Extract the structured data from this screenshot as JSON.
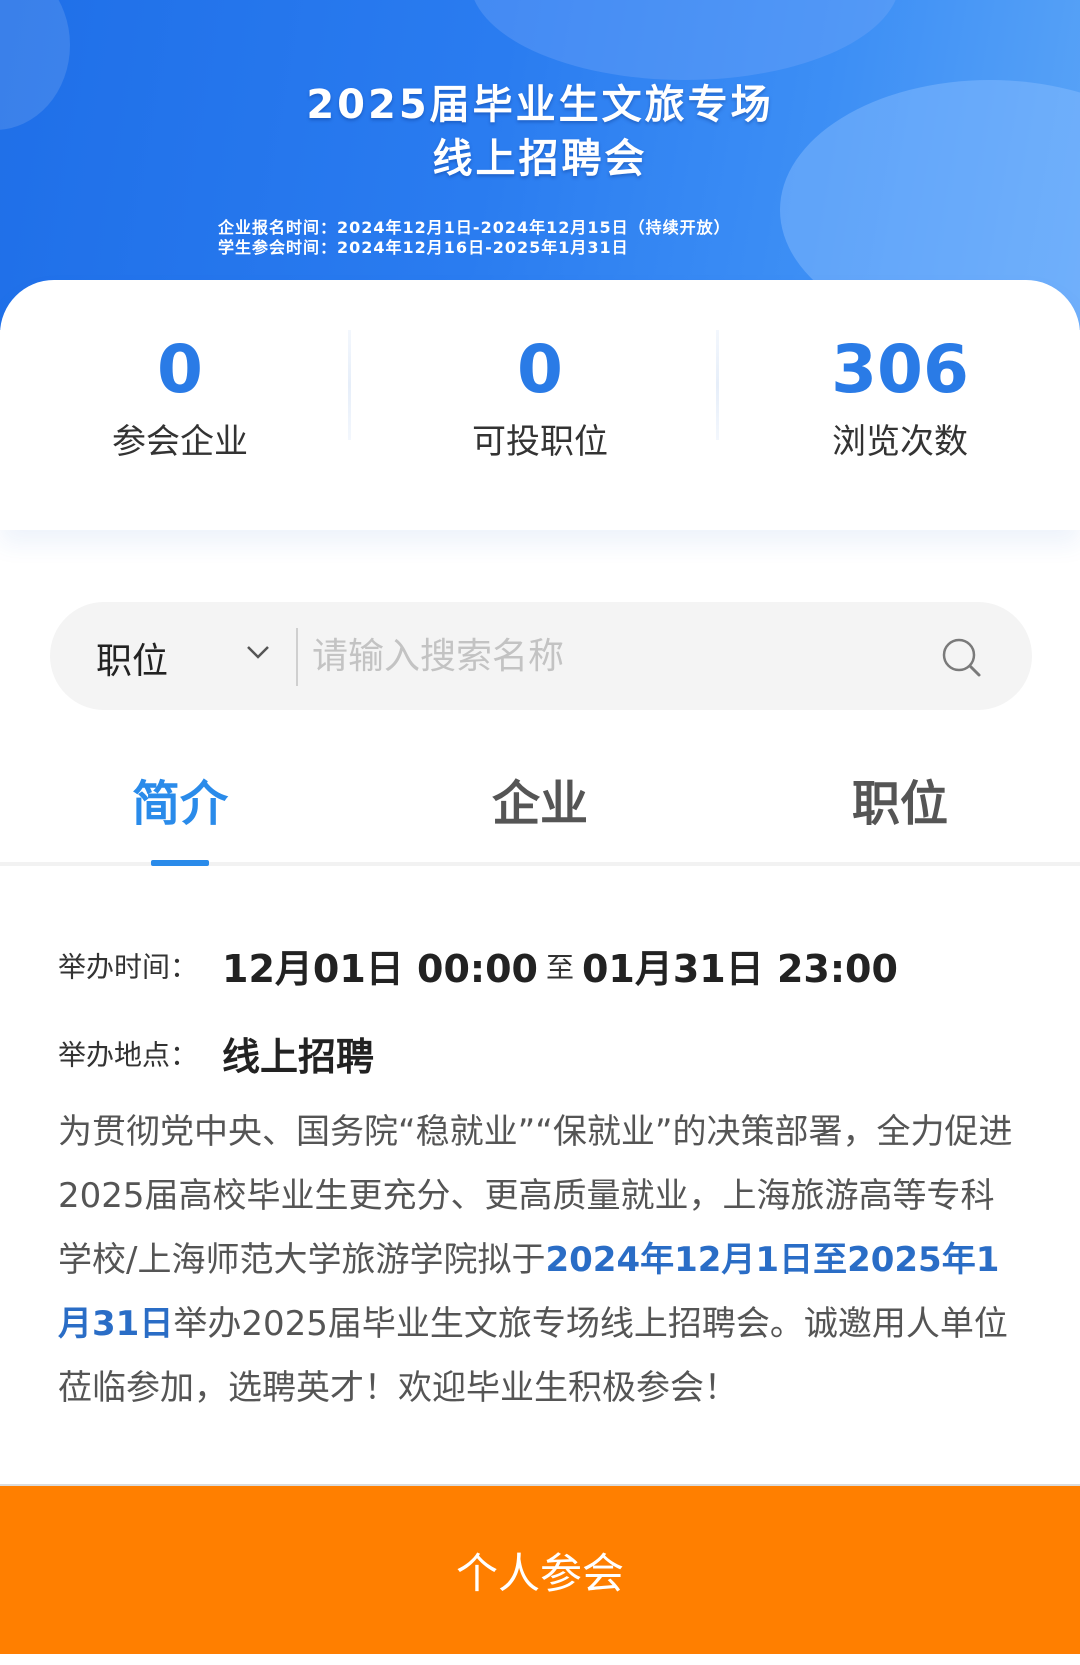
{
  "banner": {
    "title_line1": "2025届毕业生文旅专场",
    "title_line2": "线上招聘会",
    "company_signup": "企业报名时间：2024年12月1日-2024年12月15日（持续开放）",
    "student_join": "学生参会时间：2024年12月16日-2025年1月31日"
  },
  "stats": [
    {
      "value": "0",
      "label": "参会企业"
    },
    {
      "value": "0",
      "label": "可投职位"
    },
    {
      "value": "306",
      "label": "浏览次数"
    }
  ],
  "search": {
    "type_label": "职位",
    "placeholder": "请输入搜索名称",
    "value": ""
  },
  "tabs": [
    {
      "label": "简介",
      "active": true
    },
    {
      "label": "企业",
      "active": false
    },
    {
      "label": "职位",
      "active": false
    }
  ],
  "intro": {
    "time_label": "举办时间：",
    "time_start": "12月01日 00:00",
    "time_to": "至",
    "time_end": "01月31日 23:00",
    "place_label": "举办地点：",
    "place_value": "线上招聘",
    "para_part1": "为贯彻党中央、国务院“稳就业”“保就业”的决策部署，全力促进2025届高校毕业生更充分、更高质量就业，上海旅游高等专科学校/上海师范大学旅游学院拟于",
    "para_highlight": "2024年12月1日至2025年1月31日",
    "para_part2": "举办2025届毕业生文旅专场线上招聘会。诚邀用人单位莅临参加，选聘英才！欢迎毕业生积极参会！"
  },
  "join_button": "个人参会",
  "colors": {
    "brand_blue": "#2a7be6",
    "tab_active": "#2a8bea",
    "highlight": "#2a6dc6",
    "cta_orange": "#ff7f00"
  }
}
